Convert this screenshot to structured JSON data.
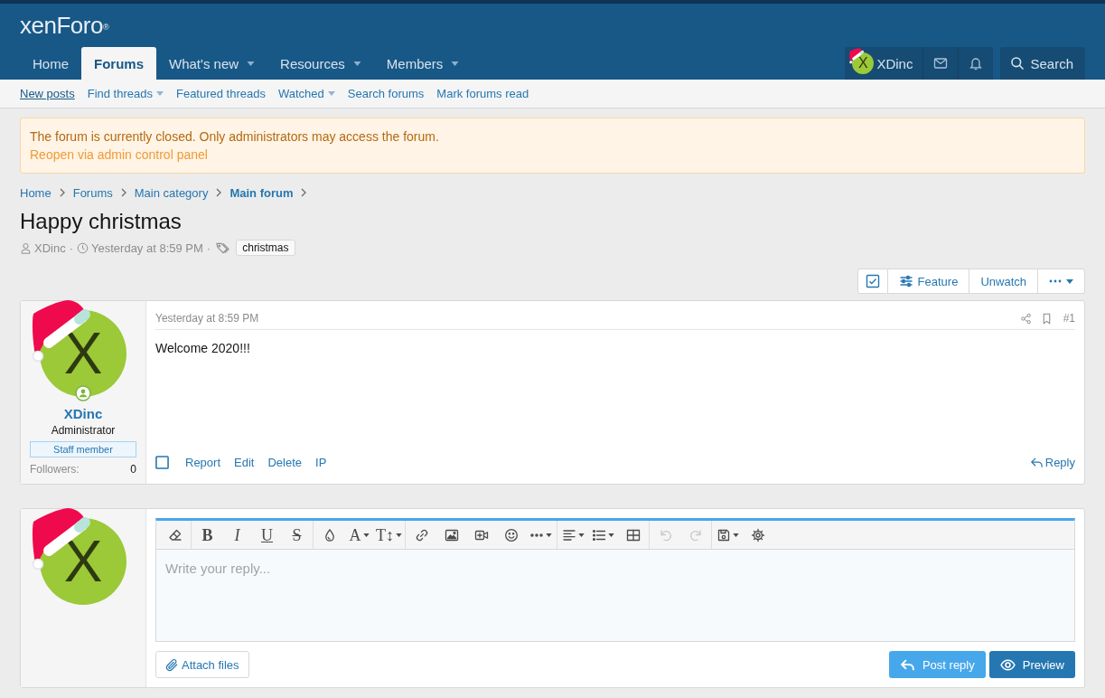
{
  "header": {
    "logo": "xenForo$^{®}$"
  },
  "nav": {
    "tabs": [
      {
        "label": "Home",
        "selected": false,
        "menu": false
      },
      {
        "label": "Forums",
        "selected": true,
        "menu": false
      },
      {
        "label": "What's new",
        "selected": false,
        "menu": true
      },
      {
        "label": "Resources",
        "selected": false,
        "menu": true
      },
      {
        "label": "Members",
        "selected": false,
        "menu": true
      }
    ],
    "account": {
      "avatar_letter": "X",
      "name": "XDinc"
    },
    "search": "Search"
  },
  "subnav": [
    {
      "label": "New posts",
      "selected": true,
      "menu": false
    },
    {
      "label": "Find threads",
      "selected": false,
      "menu": true
    },
    {
      "label": "Featured threads",
      "selected": false,
      "menu": false
    },
    {
      "label": "Watched",
      "selected": false,
      "menu": true
    },
    {
      "label": "Search forums",
      "selected": false,
      "menu": false
    },
    {
      "label": "Mark forums read",
      "selected": false,
      "menu": false
    }
  ],
  "notice": {
    "text": "The forum is currently closed. Only administrators may access the forum.",
    "link": "Reopen via admin control panel"
  },
  "breadcrumbs": [
    {
      "label": "Home",
      "current": false
    },
    {
      "label": "Forums",
      "current": false
    },
    {
      "label": "Main category",
      "current": false
    },
    {
      "label": "Main forum",
      "current": true
    }
  ],
  "thread": {
    "title": "Happy christmas",
    "meta": [
      {
        "kind": "author",
        "text": "XDinc"
      },
      {
        "kind": "separator",
        "text": "·"
      },
      {
        "kind": "date",
        "text": "Yesterday at 8:59 PM"
      },
      {
        "kind": "separator",
        "text": "·"
      },
      {
        "kind": "tags",
        "tags": [
          "christmas"
        ]
      }
    ]
  },
  "thread_tools": [
    {
      "kind": "select"
    },
    {
      "kind": "feature",
      "label": "Feature"
    },
    {
      "kind": "watch",
      "label": "Unwatch"
    },
    {
      "kind": "more"
    }
  ],
  "post": {
    "user": {
      "avatar_letter": "X",
      "online": true,
      "name": "XDinc",
      "title": "Administrator",
      "banner": "Staff member",
      "stats": [
        {
          "label": "Followers:",
          "value": "0"
        }
      ]
    },
    "date": "Yesterday at 8:59 PM",
    "number": "#1",
    "body": "Welcome 2020!!!",
    "checked": false,
    "actions": [
      "Report",
      "Edit",
      "Delete",
      "IP"
    ],
    "reply": "Reply"
  },
  "reply_form": {
    "avatar_letter": "X",
    "toolbar": [
      [
        {
          "kind": "clear",
          "disabled": false,
          "menu": false
        }
      ],
      [
        {
          "kind": "bold",
          "glyph": "B",
          "disabled": false,
          "menu": false
        },
        {
          "kind": "italic",
          "glyph": "I",
          "disabled": false,
          "menu": false
        },
        {
          "kind": "underline",
          "glyph": "U",
          "disabled": false,
          "menu": false
        },
        {
          "kind": "strike",
          "glyph": "S",
          "disabled": false,
          "menu": false
        }
      ],
      [
        {
          "kind": "color",
          "disabled": false,
          "menu": false
        },
        {
          "kind": "font",
          "glyph": "A",
          "disabled": false,
          "menu": true
        },
        {
          "kind": "size",
          "glyph": "T↕",
          "disabled": false,
          "menu": true
        }
      ],
      [
        {
          "kind": "link",
          "disabled": false,
          "menu": false
        },
        {
          "kind": "image",
          "disabled": false,
          "menu": false
        },
        {
          "kind": "media",
          "disabled": false,
          "menu": false
        },
        {
          "kind": "smilie",
          "disabled": false,
          "menu": false
        },
        {
          "kind": "more",
          "disabled": false,
          "menu": true
        }
      ],
      [
        {
          "kind": "align",
          "disabled": false,
          "menu": true
        },
        {
          "kind": "list",
          "disabled": false,
          "menu": true
        },
        {
          "kind": "table",
          "disabled": false,
          "menu": false
        }
      ],
      [
        {
          "kind": "undo",
          "disabled": true,
          "menu": false
        },
        {
          "kind": "redo",
          "disabled": true,
          "menu": false
        }
      ],
      [
        {
          "kind": "drafts",
          "disabled": false,
          "menu": true
        },
        {
          "kind": "settings",
          "disabled": false,
          "menu": false
        }
      ]
    ],
    "placeholder": "Write your reply...",
    "attach": "Attach files",
    "buttons": [
      {
        "kind": "submit",
        "label": "Post reply"
      },
      {
        "kind": "preview",
        "label": "Preview"
      }
    ]
  }
}
